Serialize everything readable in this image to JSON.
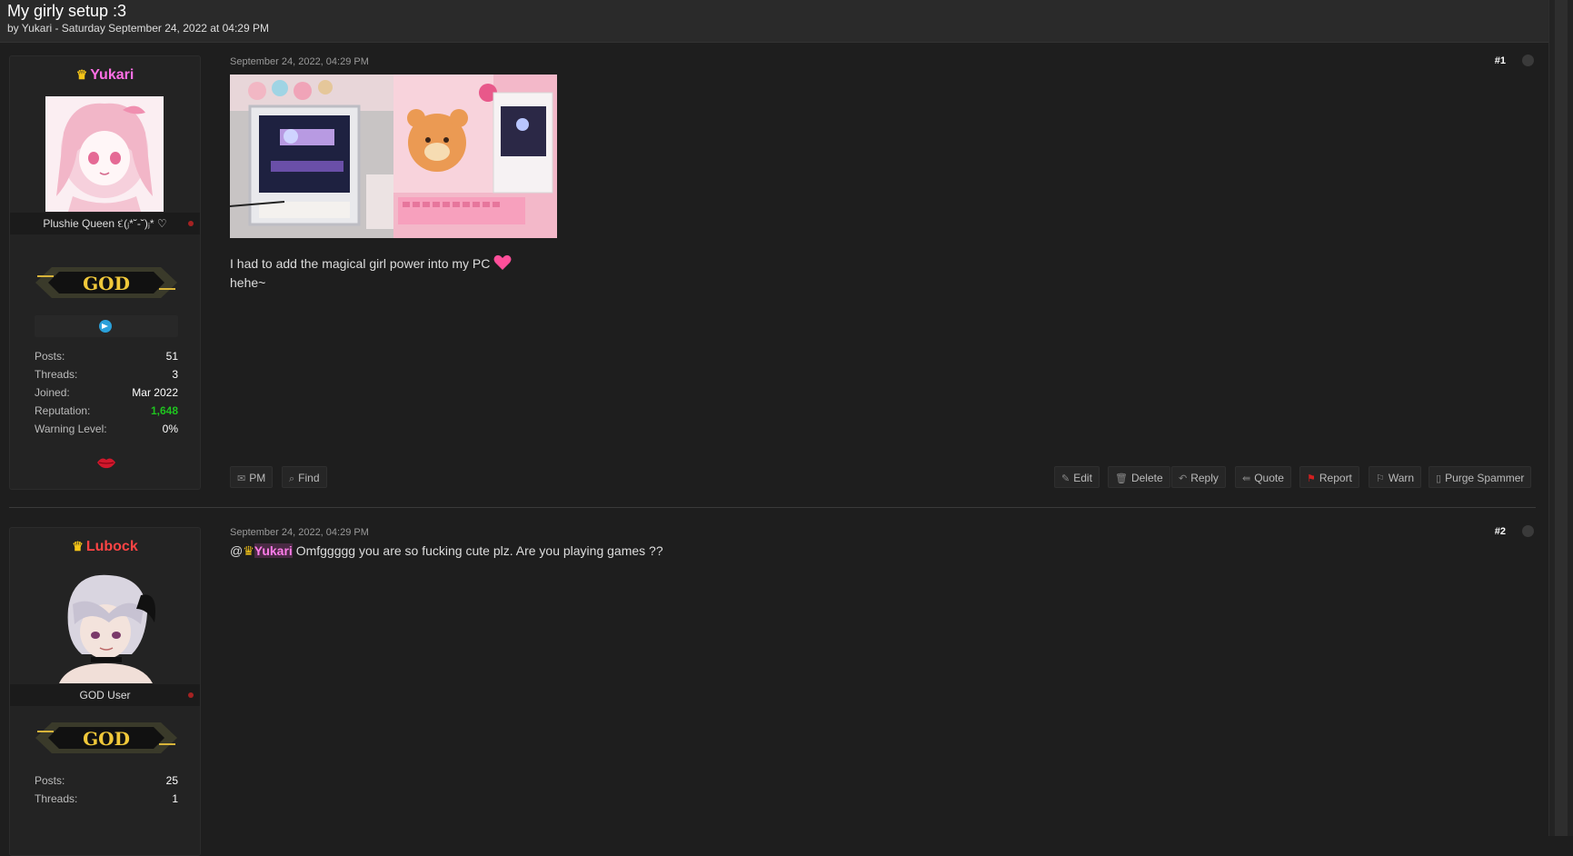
{
  "thread": {
    "title": "My girly setup :3",
    "subtitle": "by Yukari - Saturday September 24, 2022 at 04:29 PM"
  },
  "posts": [
    {
      "user": {
        "name": "Yukari",
        "name_color": "#ff6fe6",
        "title": "Plushie Queen દ(ⱼ*˘-˘)ⱼ* ♡",
        "rank_badge": "GOD",
        "stats": [
          {
            "key": "Posts:",
            "value": "51"
          },
          {
            "key": "Threads:",
            "value": "3"
          },
          {
            "key": "Joined:",
            "value": "Mar 2022"
          },
          {
            "key": "Reputation:",
            "value": "1,648"
          },
          {
            "key": "Warning Level:",
            "value": "0%"
          }
        ]
      },
      "date": "September 24, 2022, 04:29 PM",
      "number": "#1",
      "body_line1": "I had to add the magical girl power into my PC",
      "body_line2": "hehe~",
      "left_buttons": [
        {
          "label": "PM",
          "icon": "envelope-icon"
        },
        {
          "label": "Find",
          "icon": "search-icon"
        }
      ],
      "right_buttons": [
        {
          "label": "Edit",
          "icon": "pencil-icon"
        },
        {
          "label": "Delete",
          "icon": "trash-icon"
        },
        {
          "label": "Reply",
          "icon": "reply-icon"
        },
        {
          "label": "Quote",
          "icon": "quote-icon"
        },
        {
          "label": "Report",
          "icon": "flag-icon",
          "color": "#d21f1f"
        },
        {
          "label": "Warn",
          "icon": "flag-outline-icon"
        },
        {
          "label": "Purge Spammer",
          "icon": "trash-icon"
        }
      ]
    },
    {
      "user": {
        "name": "Lubock",
        "name_color": "#ff4444",
        "title": "GOD User",
        "rank_badge": "GOD",
        "stats": [
          {
            "key": "Posts:",
            "value": "25"
          },
          {
            "key": "Threads:",
            "value": "1"
          }
        ]
      },
      "date": "September 24, 2022, 04:29 PM",
      "number": "#2",
      "mention_prefix": "@",
      "mention_name": "Yukari",
      "body": "Omfggggg you are so fucking cute plz. Are you playing games ??"
    }
  ]
}
